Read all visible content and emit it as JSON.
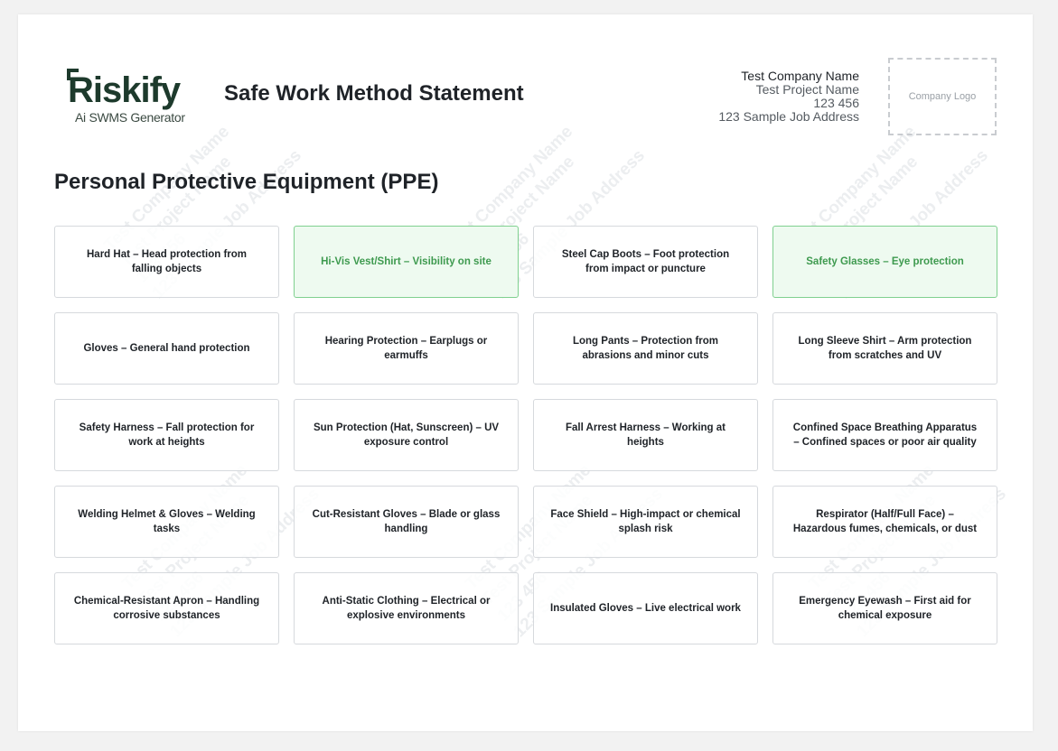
{
  "header": {
    "logo_text": "Riskify",
    "logo_subtitle": "Ai SWMS Generator",
    "document_title": "Safe Work Method Statement",
    "company_logo_placeholder": "Company Logo"
  },
  "company": {
    "name": "Test Company Name",
    "project": "Test Project Name",
    "number": "123 456",
    "address": "123 Sample Job Address"
  },
  "section": {
    "title": "Personal Protective Equipment (PPE)"
  },
  "ppe_items": [
    {
      "label": "Hard Hat – Head protection from falling objects",
      "selected": false
    },
    {
      "label": "Hi-Vis Vest/Shirt – Visibility on site",
      "selected": true
    },
    {
      "label": "Steel Cap Boots – Foot protection from impact or puncture",
      "selected": false
    },
    {
      "label": "Safety Glasses – Eye protection",
      "selected": true
    },
    {
      "label": "Gloves – General hand protection",
      "selected": false
    },
    {
      "label": "Hearing Protection – Earplugs or earmuffs",
      "selected": false
    },
    {
      "label": "Long Pants – Protection from abrasions and minor cuts",
      "selected": false
    },
    {
      "label": "Long Sleeve Shirt – Arm protection from scratches and UV",
      "selected": false
    },
    {
      "label": "Safety Harness – Fall protection for work at heights",
      "selected": false
    },
    {
      "label": "Sun Protection (Hat, Sunscreen) – UV exposure control",
      "selected": false
    },
    {
      "label": "Fall Arrest Harness – Working at heights",
      "selected": false
    },
    {
      "label": "Confined Space Breathing Apparatus – Confined spaces or poor air quality",
      "selected": false
    },
    {
      "label": "Welding Helmet & Gloves – Welding tasks",
      "selected": false
    },
    {
      "label": "Cut-Resistant Gloves – Blade or glass handling",
      "selected": false
    },
    {
      "label": "Face Shield – High-impact or chemical splash risk",
      "selected": false
    },
    {
      "label": "Respirator (Half/Full Face) – Hazardous fumes, chemicals, or dust",
      "selected": false
    },
    {
      "label": "Chemical-Resistant Apron – Handling corrosive substances",
      "selected": false
    },
    {
      "label": "Anti-Static Clothing – Electrical or explosive environments",
      "selected": false
    },
    {
      "label": "Insulated Gloves – Live electrical work",
      "selected": false
    },
    {
      "label": "Emergency Eyewash – First aid for chemical exposure",
      "selected": false
    }
  ],
  "colors": {
    "selected_bg": "#eefaf0",
    "selected_border": "#7fd08f",
    "selected_text": "#3e9a4f",
    "brand": "#1d3a2c"
  }
}
